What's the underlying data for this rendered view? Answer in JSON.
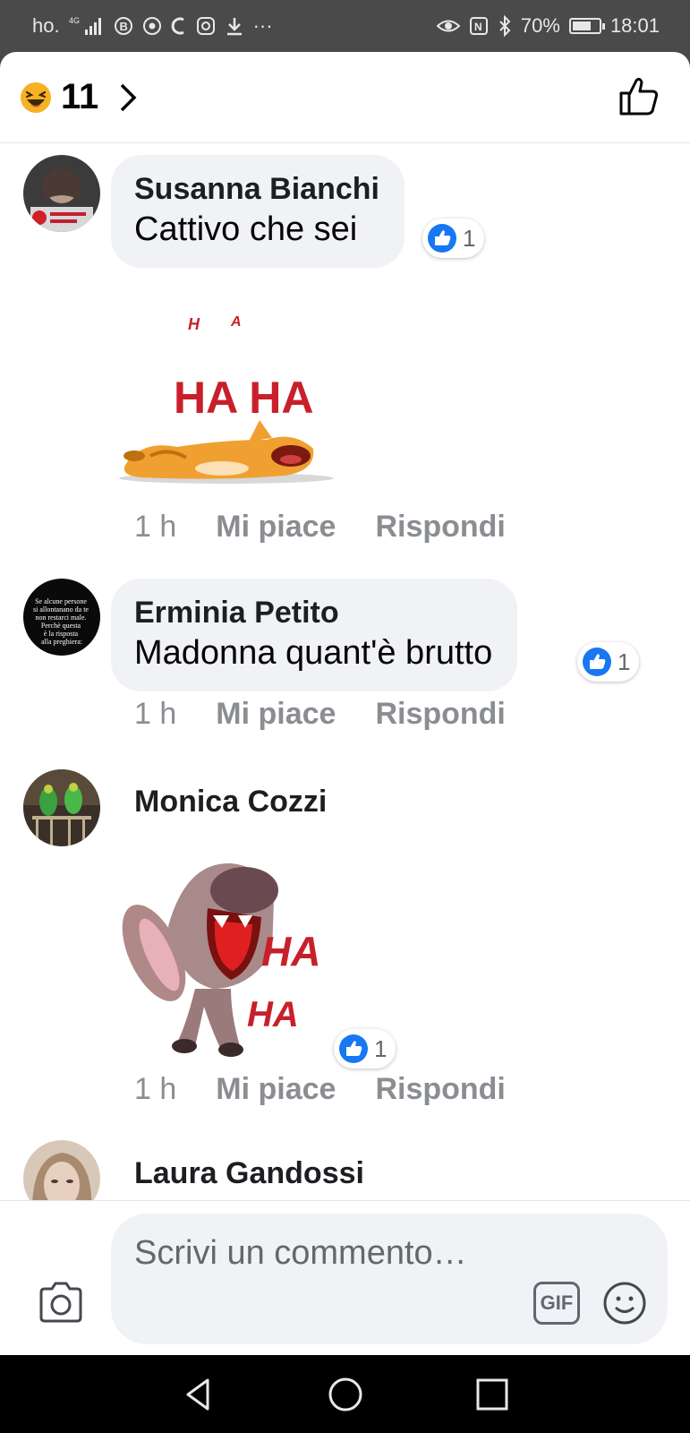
{
  "status_bar": {
    "carrier": "ho.",
    "network": "4G",
    "extra_icons": "···",
    "battery_text": "70%",
    "battery_level": 0.7,
    "time": "18:01"
  },
  "header": {
    "reaction_icon": "haha-emoji-icon",
    "reaction_count": "11"
  },
  "comments": [
    {
      "author": "Susanna Bianchi",
      "text": "Cattivo che sei",
      "reaction_count": "1",
      "sticker_caption": "HA HA",
      "time": "1 h",
      "like_label": "Mi piace",
      "reply_label": "Rispondi"
    },
    {
      "author": "Erminia Petito",
      "text": "Madonna quant'è brutto",
      "reaction_count": "1",
      "time": "1 h",
      "like_label": "Mi piace",
      "reply_label": "Rispondi",
      "avatar_text": "Se alcune persone si allontanano da te non restarci male. Perchè questa è la risposta alla preghiera:"
    },
    {
      "author": "Monica Cozzi",
      "sticker_caption": "HA HA",
      "reaction_count": "1",
      "time": "1 h",
      "like_label": "Mi piace",
      "reply_label": "Rispondi"
    },
    {
      "author": "Laura Gandossi"
    }
  ],
  "composer": {
    "placeholder": "Scrivi un commento…",
    "gif_label": "GIF"
  },
  "colors": {
    "like_blue": "#1877f2",
    "bubble_bg": "#f0f2f5",
    "meta_gray": "#8a8d91",
    "haha_yellow": "#f7b125"
  }
}
